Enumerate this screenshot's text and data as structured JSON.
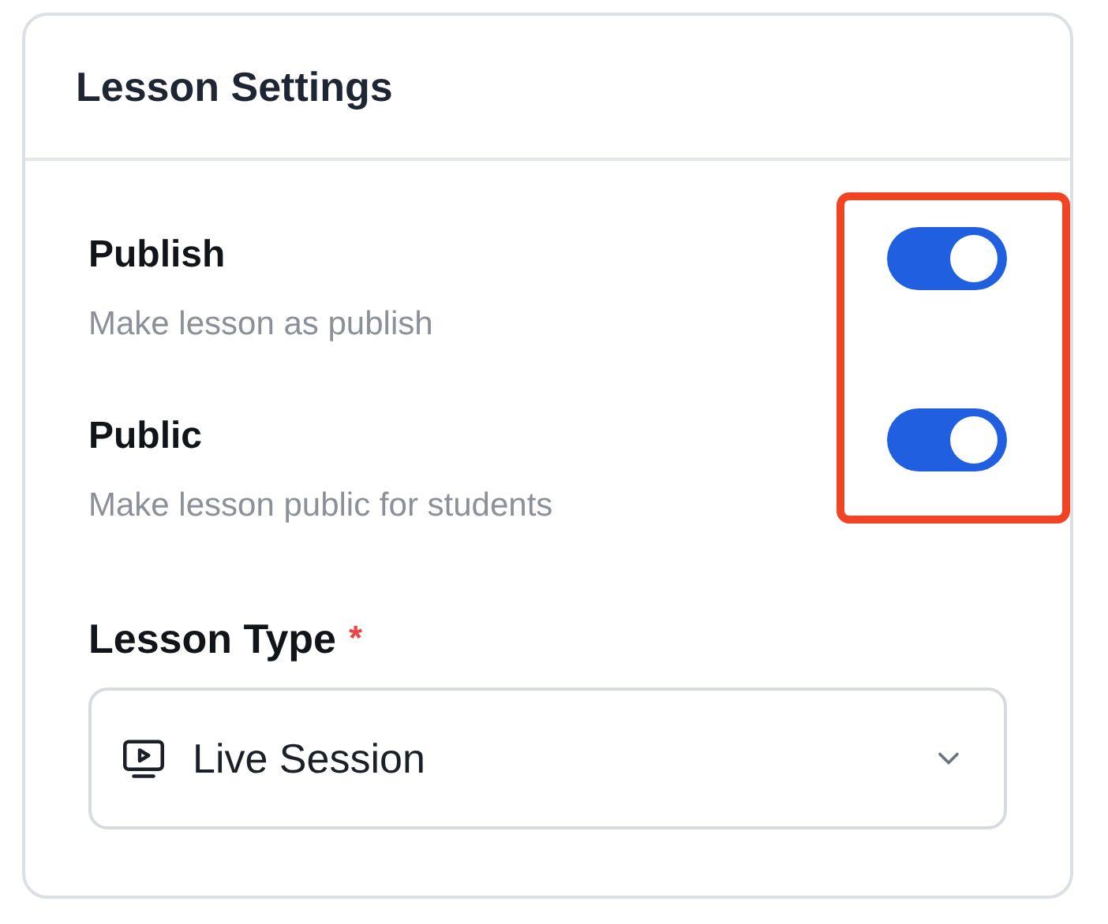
{
  "card": {
    "title": "Lesson Settings"
  },
  "settings": [
    {
      "label": "Publish",
      "description": "Make lesson as publish",
      "on": true
    },
    {
      "label": "Public",
      "description": "Make lesson public for students",
      "on": true
    }
  ],
  "toggles_highlighted": true,
  "lesson_type": {
    "label": "Lesson Type",
    "required_mark": "*",
    "value": "Live Session"
  }
}
